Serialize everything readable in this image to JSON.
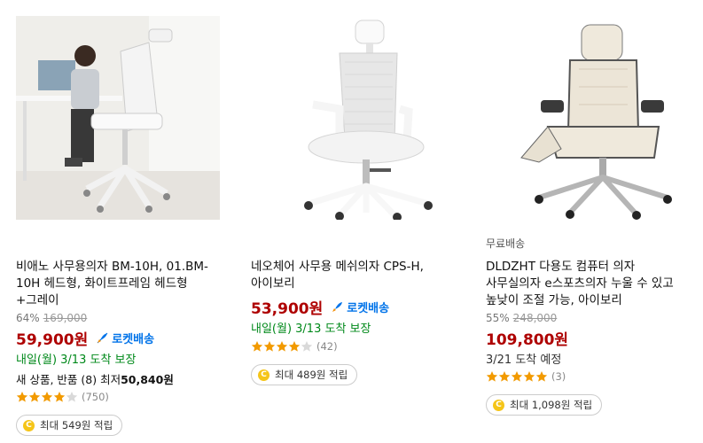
{
  "products": [
    {
      "name": "비애노 사무용의자 BM-10H, 01.BM-10H 헤드형, 화이트프레임 헤드형+그레이",
      "discount": "64%",
      "original_price": "169,000",
      "price": "59,900원",
      "rocket": "로켓배송",
      "delivery": "내일(월) 3/13 도착 보장",
      "extra_prefix": "새 상품, 반품 (8) 최저",
      "extra_value": "50,840원",
      "rating": 4,
      "review_count": "(750)",
      "cashback": "최대 549원 적립"
    },
    {
      "name": "네오체어 사무용 메쉬의자 CPS-H, 아이보리",
      "price": "53,900원",
      "rocket": "로켓배송",
      "delivery": "내일(월) 3/13 도착 보장",
      "rating": 4,
      "review_count": "(42)",
      "cashback": "최대 489원 적립"
    },
    {
      "badge": "무료배송",
      "name": "DLDZHT 다용도 컴퓨터 의자 사무실의자 e스포츠의자 누울 수 있고 높낮이 조절 가능, 아이보리",
      "discount": "55%",
      "original_price": "248,000",
      "price": "109,800원",
      "delivery": "3/21 도착 예정",
      "rating": 5,
      "review_count": "(3)",
      "cashback": "최대 1,098원 적립"
    }
  ],
  "coin_label": "C",
  "colors": {
    "price": "#ae0000",
    "rocket": "#0073e9",
    "delivery_guaranteed": "#00891a",
    "star": "#f29a00",
    "coin": "#f5c518"
  },
  "icons": {
    "rocket": "rocket-icon",
    "star": "star-icon",
    "coin": "cash-coin-icon"
  }
}
